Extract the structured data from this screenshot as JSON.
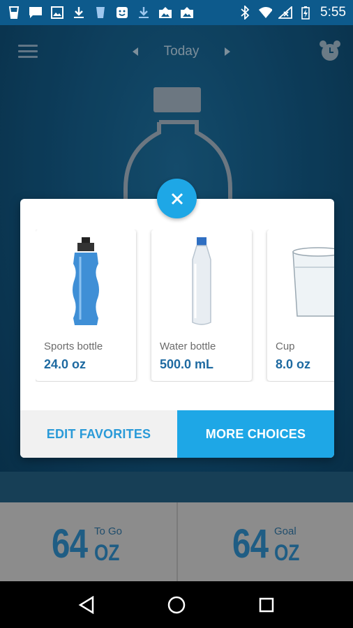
{
  "status_bar": {
    "time": "5:55",
    "left_icons": [
      "glass-icon",
      "message-icon",
      "image-icon",
      "download-icon",
      "cup-icon",
      "app-icon",
      "download-icon",
      "photo-upload-icon",
      "photo-upload-icon"
    ],
    "right_icons": [
      "bluetooth-icon",
      "wifi-icon",
      "no-signal-icon",
      "battery-charging-icon"
    ]
  },
  "header": {
    "day_label": "Today",
    "icons": [
      "menu-icon",
      "chevron-left-icon",
      "chevron-right-icon",
      "alarm-clock-icon"
    ]
  },
  "dialog": {
    "close_icon": "close-icon",
    "items": [
      {
        "name": "Sports bottle",
        "size": "24.0 oz",
        "icon": "sports-bottle-icon"
      },
      {
        "name": "Water bottle",
        "size": "500.0 mL",
        "icon": "water-bottle-icon"
      },
      {
        "name": "Cup",
        "size": "8.0 oz",
        "icon": "cup-icon"
      }
    ],
    "edit_label": "EDIT FAVORITES",
    "more_label": "MORE CHOICES"
  },
  "stats": {
    "to_go": {
      "value": "64",
      "label": "To Go",
      "unit": "OZ"
    },
    "goal": {
      "value": "64",
      "label": "Goal",
      "unit": "OZ"
    }
  },
  "nav": [
    "back-icon",
    "home-icon",
    "recents-icon"
  ],
  "colors": {
    "accent": "#1ea7e6",
    "status_bar": "#0d5a8c",
    "stat_text": "#1f5d84"
  }
}
